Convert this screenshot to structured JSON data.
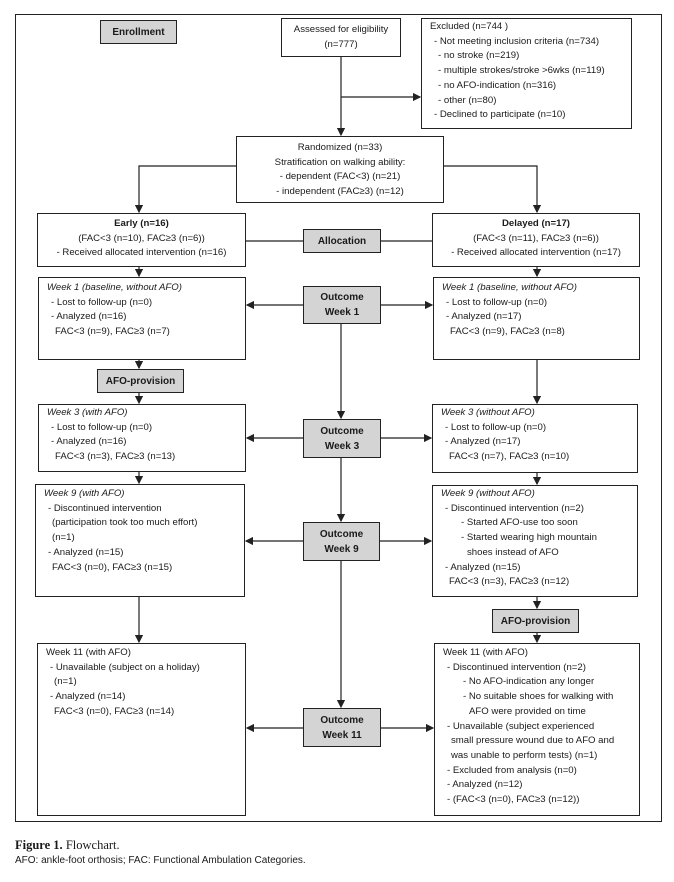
{
  "stages": {
    "enrollment": "Enrollment",
    "allocation": "Allocation",
    "afo_provision": "AFO-provision",
    "outcome": "Outcome",
    "week1": "Week 1",
    "week3": "Week 3",
    "week9": "Week 9",
    "week11": "Week 11"
  },
  "assessed": [
    "Assessed for eligibility",
    "(n=777)"
  ],
  "excluded": [
    "Excluded (n=744 )",
    "- Not meeting inclusion criteria (n=734)",
    "- no stroke (n=219)",
    "- multiple strokes/stroke >6wks (n=119)",
    "- no AFO-indication (n=316)",
    "- other (n=80)",
    "- Declined to participate (n=10)"
  ],
  "randomized": [
    "Randomized (n=33)",
    "Stratification on walking ability:",
    "- dependent (FAC<3) (n=21)",
    "- independent (FAC≥3) (n=12)"
  ],
  "early": [
    "Early (n=16)",
    "(FAC<3 (n=10), FAC≥3 (n=6))",
    "- Received allocated intervention (n=16)"
  ],
  "delayed": [
    "Delayed (n=17)",
    "(FAC<3 (n=11), FAC≥3 (n=6))",
    "- Received allocated intervention (n=17)"
  ],
  "early_w1": [
    "Week 1 (baseline, without AFO)",
    "- Lost to follow-up (n=0)",
    "- Analyzed (n=16)",
    "FAC<3 (n=9), FAC≥3 (n=7)"
  ],
  "delayed_w1": [
    "Week 1 (baseline, without AFO)",
    "- Lost to follow-up (n=0)",
    "- Analyzed (n=17)",
    "FAC<3 (n=9), FAC≥3 (n=8)"
  ],
  "early_w3": [
    "Week 3 (with AFO)",
    "- Lost to follow-up (n=0)",
    "- Analyzed (n=16)",
    "FAC<3 (n=3), FAC≥3 (n=13)"
  ],
  "delayed_w3": [
    "Week 3 (without AFO)",
    "- Lost to follow-up (n=0)",
    "- Analyzed (n=17)",
    "FAC<3 (n=7), FAC≥3 (n=10)"
  ],
  "early_w9": [
    "Week 9 (with AFO)",
    "- Discontinued intervention",
    "(participation took too much effort)",
    "(n=1)",
    "- Analyzed (n=15)",
    "FAC<3 (n=0), FAC≥3 (n=15)"
  ],
  "delayed_w9": [
    "Week 9 (without AFO)",
    "- Discontinued intervention (n=2)",
    "- Started AFO-use too soon",
    "- Started wearing high mountain",
    "shoes instead of AFO",
    "- Analyzed (n=15)",
    "FAC<3 (n=3), FAC≥3 (n=12)"
  ],
  "early_w11": [
    "Week 11 (with AFO)",
    "- Unavailable (subject on a holiday)",
    "(n=1)",
    "- Analyzed (n=14)",
    "FAC<3 (n=0), FAC≥3 (n=14)"
  ],
  "delayed_w11": [
    "Week 11 (with AFO)",
    "- Discontinued intervention (n=2)",
    "- No AFO-indication any longer",
    "- No suitable shoes for walking with",
    "AFO were provided on time",
    "- Unavailable (subject experienced",
    "small pressure wound due to AFO and",
    "was unable to perform tests) (n=1)",
    "- Excluded from analysis (n=0)",
    "- Analyzed (n=12)",
    "- (FAC<3 (n=0), FAC≥3 (n=12))"
  ],
  "caption": {
    "label": "Figure 1.",
    "title": "Flowchart.",
    "note": "AFO: ankle-foot orthosis; FAC: Functional Ambulation Categories."
  },
  "colors": {
    "stage_fill": "#d4d4d4",
    "line": "#222222"
  }
}
